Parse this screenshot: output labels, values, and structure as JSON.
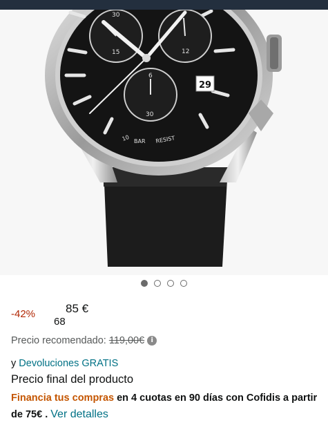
{
  "carousel": {
    "image_alt": "Reloj cronógrafo con esfera negra y correa de cuero negra",
    "dial_marks": {
      "sub_top_left": "30",
      "sub_left_bottom": "15",
      "sub_right_bottom": "12",
      "sub_bottom_top": "6",
      "sub_bottom_bottom": "30",
      "date": "29",
      "depth_left": "10",
      "depth_mid": "BAR",
      "depth_right": "RESIST"
    },
    "dots": [
      {
        "active": true
      },
      {
        "active": false
      },
      {
        "active": false
      },
      {
        "active": false
      }
    ]
  },
  "price": {
    "discount": "-42%",
    "whole": "68",
    "fraction": "85 €"
  },
  "recommended": {
    "label": "Precio recomendado:",
    "value": "119,00€"
  },
  "returns": {
    "prefix": "y",
    "link": "Devoluciones GRATIS"
  },
  "final_price_label": "Precio final del producto",
  "financing": {
    "link": "Financia tus compras",
    "text": "en 4 cuotas en 90 días con Cofidis a partir de 75€",
    "separator": ".",
    "details_link": "Ver detalles"
  },
  "colors": {
    "topbar": "#232f3e",
    "discount": "#b12704",
    "link": "#007185",
    "finance_link": "#c45500"
  }
}
